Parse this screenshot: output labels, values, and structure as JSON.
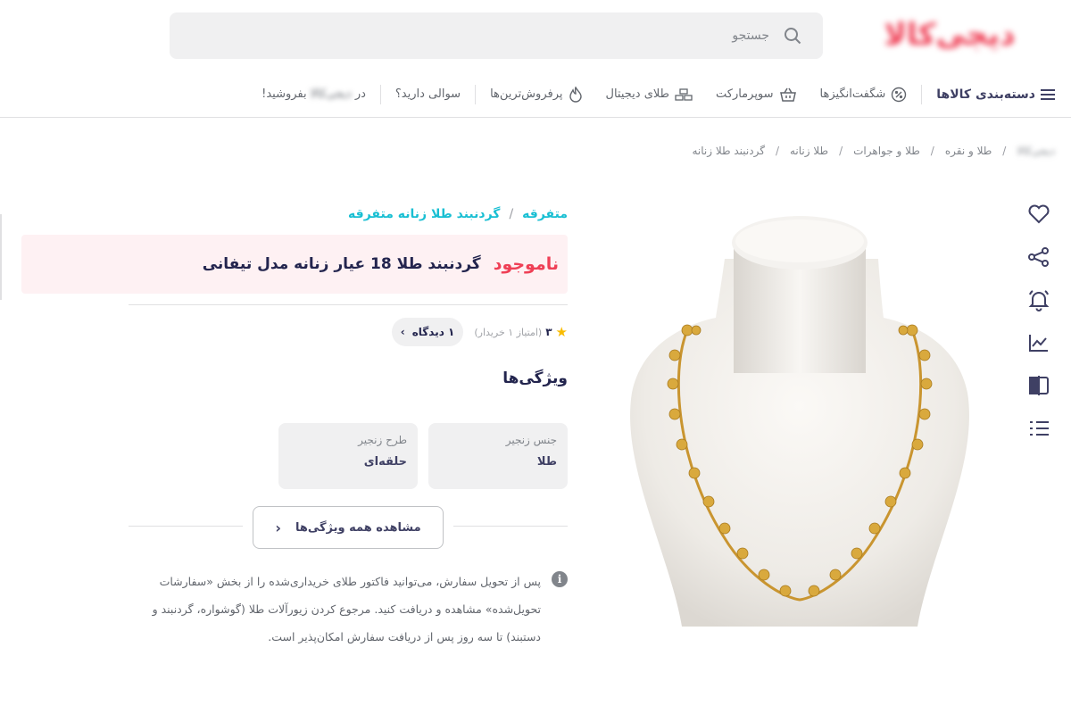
{
  "header": {
    "logo_text": "دیجی‌کالا",
    "search_placeholder": "جستجو"
  },
  "nav": {
    "category_label": "دسته‌بندی کالاها",
    "items": [
      {
        "label": "شگفت‌انگیزها",
        "icon": "percent-icon"
      },
      {
        "label": "سوپرمارکت",
        "icon": "basket-icon"
      },
      {
        "label": "طلای دیجیتال",
        "icon": "gold-bars-icon"
      },
      {
        "label": "پرفروش‌ترین‌ها",
        "icon": "fire-icon"
      },
      {
        "label": "سوالی دارید؟",
        "icon": ""
      }
    ],
    "sell_prefix": "در",
    "sell_brand": "دیجی‌کالا",
    "sell_suffix": "بفروشید!"
  },
  "breadcrumb": [
    "دیجی‌کالا",
    "طلا و نقره",
    "طلا و جواهرات",
    "طلا زنانه",
    "گردنبند طلا زنانه"
  ],
  "product": {
    "subcategory": [
      "متفرقه",
      "گردنبند طلا زنانه متفرقه"
    ],
    "status": "ناموجود",
    "title": "گردنبند طلا 18 عیار زنانه مدل تیفانی",
    "rating": "۳",
    "rating_count": "(امتیاز ۱ خریدار)",
    "reviews_label": "۱ دیدگاه",
    "features_title": "ویژگی‌ها",
    "features": [
      {
        "key": "جنس زنجیر",
        "value": "طلا"
      },
      {
        "key": "طرح زنجیر",
        "value": "حلقه‌ای"
      }
    ],
    "show_all_features": "مشاهده همه ویژگی‌ها",
    "note": "پس از تحویل سفارش، می‌توانید فاکتور طلای خریداری‌شده را از بخش «سفارشات تحویل‌شده» مشاهده و دریافت کنید. مرجوع کردن زیورآلات طلا (گوشواره، گردنبند و دستبند) تا سه روز پس از دریافت سفارش امکان‌پذیر است."
  },
  "tools": [
    "heart-icon",
    "share-icon",
    "bell-icon",
    "price-chart-icon",
    "compare-icon",
    "list-icon"
  ],
  "colors": {
    "accent": "#19bfd3",
    "brand": "#ef4056",
    "title_bg": "#fef1f3",
    "star": "#f9bc00"
  }
}
